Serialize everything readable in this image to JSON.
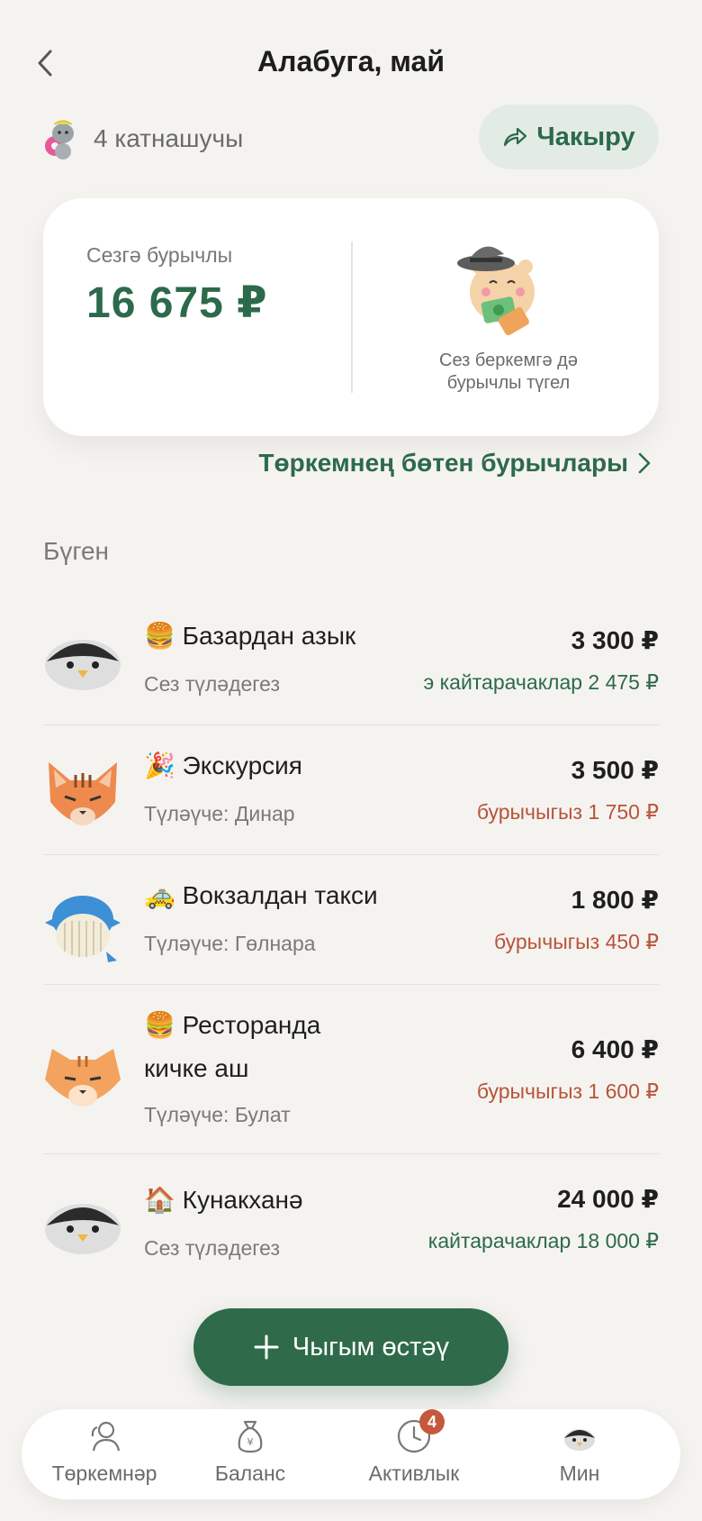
{
  "header": {
    "title": "Алабуга, май",
    "members_label": "4 катнашучы",
    "invite_label": "Чакыру"
  },
  "balance": {
    "owed_label": "Сезгә бурычлы",
    "owed_amount": "16 675 ₽",
    "caption_line1": "Сез беркемгә дә",
    "caption_line2": "бурычлы түгел",
    "all_debts_link": "Төркемнең бөтен бурычлары"
  },
  "section": {
    "title": "Бүген"
  },
  "expenses": [
    {
      "emoji": "🍔",
      "title": "Базардан азык",
      "title2": "",
      "subtitle": "Сез түләдегез",
      "amount": "3 300 ₽",
      "share": "э кайтарачаклар 2 475 ₽",
      "share_status": "green",
      "avatar": "penguin-avatar"
    },
    {
      "emoji": "🎉",
      "title": "Экскурсия",
      "title2": "",
      "subtitle": "Түләүче: Динар",
      "amount": "3 500 ₽",
      "share": "бурычыгыз 1 750 ₽",
      "share_status": "red",
      "avatar": "cat-avatar"
    },
    {
      "emoji": "🚕",
      "title": "Вокзалдан такси",
      "title2": "",
      "subtitle": "Түләүче: Гөлнара",
      "amount": "1 800 ₽",
      "share": "бурычыгыз 450 ₽",
      "share_status": "red",
      "avatar": "whale-avatar"
    },
    {
      "emoji": "🍔",
      "title": "Ресторанда",
      "title2": "кичке аш",
      "subtitle": "Түләүче: Булат",
      "amount": "6 400 ₽",
      "share": "бурычыгыз 1 600 ₽",
      "share_status": "red",
      "avatar": "tiger-avatar"
    },
    {
      "emoji": "🏠",
      "title": "Кунакханә",
      "title2": "",
      "subtitle": "Сез түләдегез",
      "amount": "24 000 ₽",
      "share": "кайтарачаклар 18 000 ₽",
      "share_status": "green",
      "avatar": "penguin-avatar"
    }
  ],
  "actions": {
    "add_expense_label": "Чыгым өстәү"
  },
  "nav": {
    "groups_label": "Төркемнәр",
    "balance_label": "Баланс",
    "activity_label": "Активлык",
    "activity_badge": "4",
    "me_label": "Мин"
  },
  "colors": {
    "accent": "#2c6a4b",
    "debt": "#b8543a",
    "background": "#f5f3f0"
  }
}
